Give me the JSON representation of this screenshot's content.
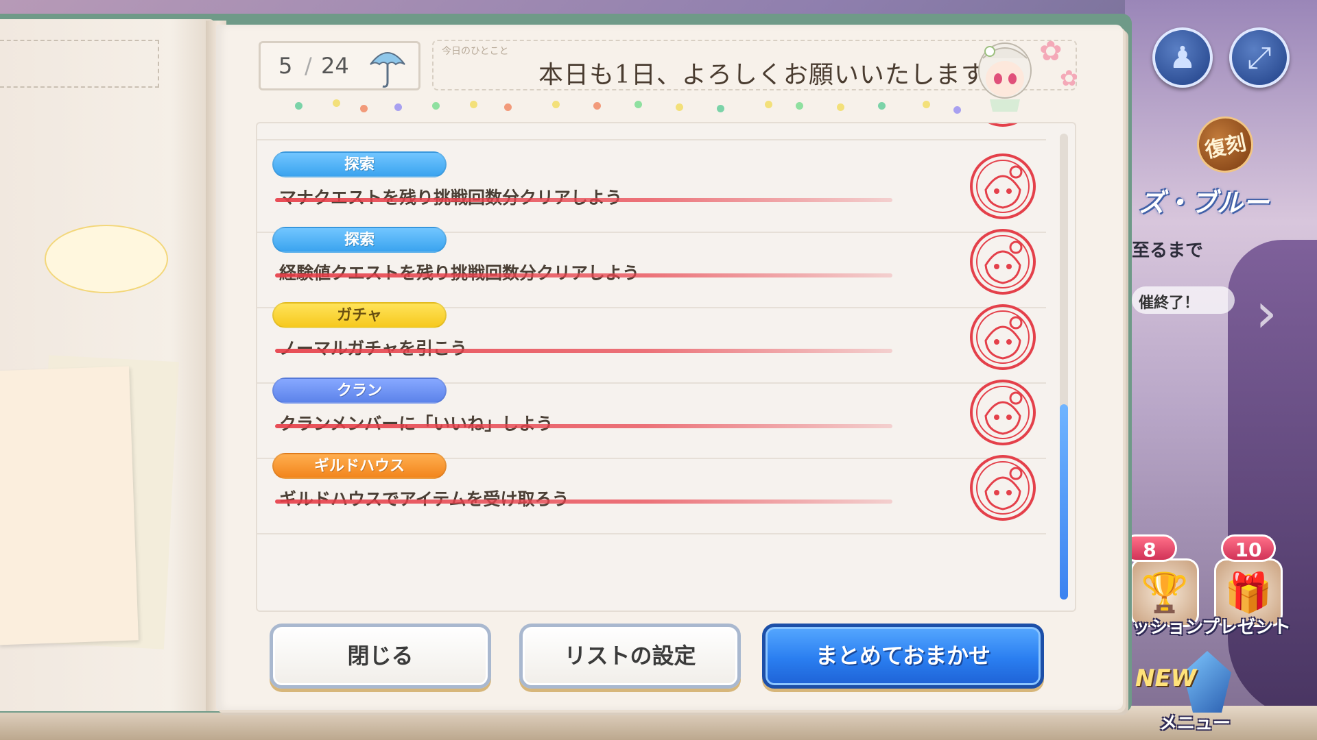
{
  "header": {
    "page_current": "5",
    "page_separator": "/",
    "page_total": "24",
    "greeting_label": "今日のひとこと",
    "greeting": "本日も1日、よろしくお願いいたします。"
  },
  "quests": [
    {
      "tag": "探索",
      "tag_type": "explore",
      "text": "マナクエストを残り挑戦回数分クリアしよう",
      "completed": true
    },
    {
      "tag": "探索",
      "tag_type": "explore",
      "text": "経験値クエストを残り挑戦回数分クリアしよう",
      "completed": true
    },
    {
      "tag": "ガチャ",
      "tag_type": "gacha",
      "text": "ノーマルガチャを引こう",
      "completed": true
    },
    {
      "tag": "クラン",
      "tag_type": "clan",
      "text": "クランメンバーに「いいね」しよう",
      "completed": true
    },
    {
      "tag": "ギルドハウス",
      "tag_type": "guild",
      "text": "ギルドハウスでアイテムを受け取ろう",
      "completed": true
    }
  ],
  "buttons": {
    "close": "閉じる",
    "list_settings": "リストの設定",
    "auto": "まとめておまかせ"
  },
  "hud": {
    "event_revival": "復刻",
    "event_title": "ズ・ブルー",
    "event_sub": "至るまで",
    "event_end": "催終了！",
    "mission_count": "8",
    "mission_label": "ッション",
    "present_count": "10",
    "present_label": "プレゼント",
    "new_label": "NEW",
    "menu_label": "メニュー"
  },
  "colors": {
    "explore": "#3aa3ef",
    "gacha": "#f6c91e",
    "clan": "#5c83ea",
    "guild": "#f2851c",
    "primary_button": "#2a7ef0",
    "strike": "#e63c46"
  },
  "icons": {
    "page_icon": "umbrella-icon",
    "stamp": "completed-stamp-icon",
    "character": "chibi-character-icon"
  }
}
